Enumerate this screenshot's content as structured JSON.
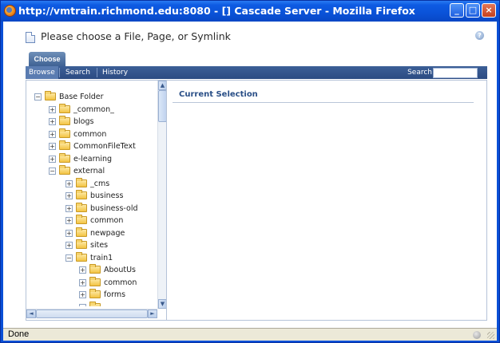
{
  "window": {
    "title": "http://vmtrain.richmond.edu:8080 - [] Cascade Server - Mozilla Firefox",
    "minimize_icon": "minimize-icon",
    "maximize_icon": "maximize-icon",
    "close_icon": "close-icon"
  },
  "dialog": {
    "title": "Please choose a File, Page, or Symlink",
    "help_glyph": "?"
  },
  "tabs": [
    {
      "label": "Choose"
    }
  ],
  "nav": {
    "items": [
      {
        "label": "Browse"
      },
      {
        "label": "Search"
      },
      {
        "label": "History"
      }
    ],
    "search_label": "Search",
    "search_value": ""
  },
  "tree": {
    "nodes": [
      {
        "label": "Base Folder",
        "sign": "−"
      },
      {
        "label": "_common_",
        "sign": "+"
      },
      {
        "label": "blogs",
        "sign": "+"
      },
      {
        "label": "common",
        "sign": "+"
      },
      {
        "label": "CommonFileText",
        "sign": "+"
      },
      {
        "label": "e-learning",
        "sign": "+"
      },
      {
        "label": "external",
        "sign": "−"
      },
      {
        "label": "_cms",
        "sign": "+"
      },
      {
        "label": "business",
        "sign": "+"
      },
      {
        "label": "business-old",
        "sign": "+"
      },
      {
        "label": "common",
        "sign": "+"
      },
      {
        "label": "newpage",
        "sign": "+"
      },
      {
        "label": "sites",
        "sign": "+"
      },
      {
        "label": "train1",
        "sign": "−"
      },
      {
        "label": "AboutUs",
        "sign": "+"
      },
      {
        "label": "common",
        "sign": "+"
      },
      {
        "label": "forms",
        "sign": "+"
      }
    ]
  },
  "selection": {
    "title": "Current Selection"
  },
  "scroll": {
    "up": "▲",
    "down": "▼",
    "left": "◄",
    "right": "►"
  },
  "status": {
    "text": "Done"
  },
  "colors": {
    "title_bar": "#0a52d8",
    "nav_bar": "#2b4b82",
    "accent_text": "#2a4f87"
  }
}
